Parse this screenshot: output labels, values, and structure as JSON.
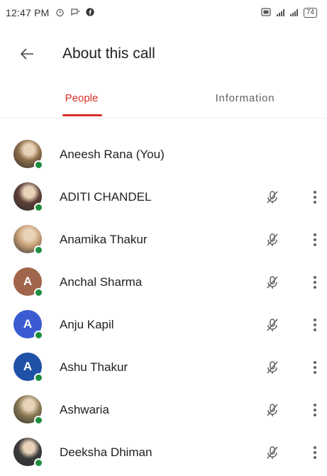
{
  "status_bar": {
    "time": "12:47 PM",
    "battery": "74"
  },
  "header": {
    "title": "About this call"
  },
  "tabs": [
    {
      "label": "People",
      "active": true
    },
    {
      "label": "Information",
      "active": false
    }
  ],
  "accent_color": "#d93025",
  "online_color": "#1e8e3e",
  "participants": [
    {
      "name": "Aneesh Rana (You)",
      "avatar_type": "photo",
      "avatar_color": "#8d6e4a",
      "initial": "",
      "show_controls": false
    },
    {
      "name": "ADITI CHANDEL",
      "avatar_type": "photo",
      "avatar_color": "#5d4037",
      "initial": "",
      "show_controls": true
    },
    {
      "name": "Anamika Thakur",
      "avatar_type": "photo",
      "avatar_color": "#c9a27a",
      "initial": "",
      "show_controls": true
    },
    {
      "name": "Anchal Sharma",
      "avatar_type": "letter",
      "avatar_color": "#a0654a",
      "initial": "A",
      "show_controls": true
    },
    {
      "name": "Anju Kapil",
      "avatar_type": "letter",
      "avatar_color": "#3a5bd1",
      "initial": "A",
      "show_controls": true
    },
    {
      "name": "Ashu Thakur",
      "avatar_type": "letter",
      "avatar_color": "#2051a8",
      "initial": "A",
      "show_controls": true
    },
    {
      "name": "Ashwaria",
      "avatar_type": "photo",
      "avatar_color": "#8b7a55",
      "initial": "",
      "show_controls": true
    },
    {
      "name": "Deeksha Dhiman",
      "avatar_type": "photo",
      "avatar_color": "#3b3b3b",
      "initial": "",
      "show_controls": true
    }
  ]
}
